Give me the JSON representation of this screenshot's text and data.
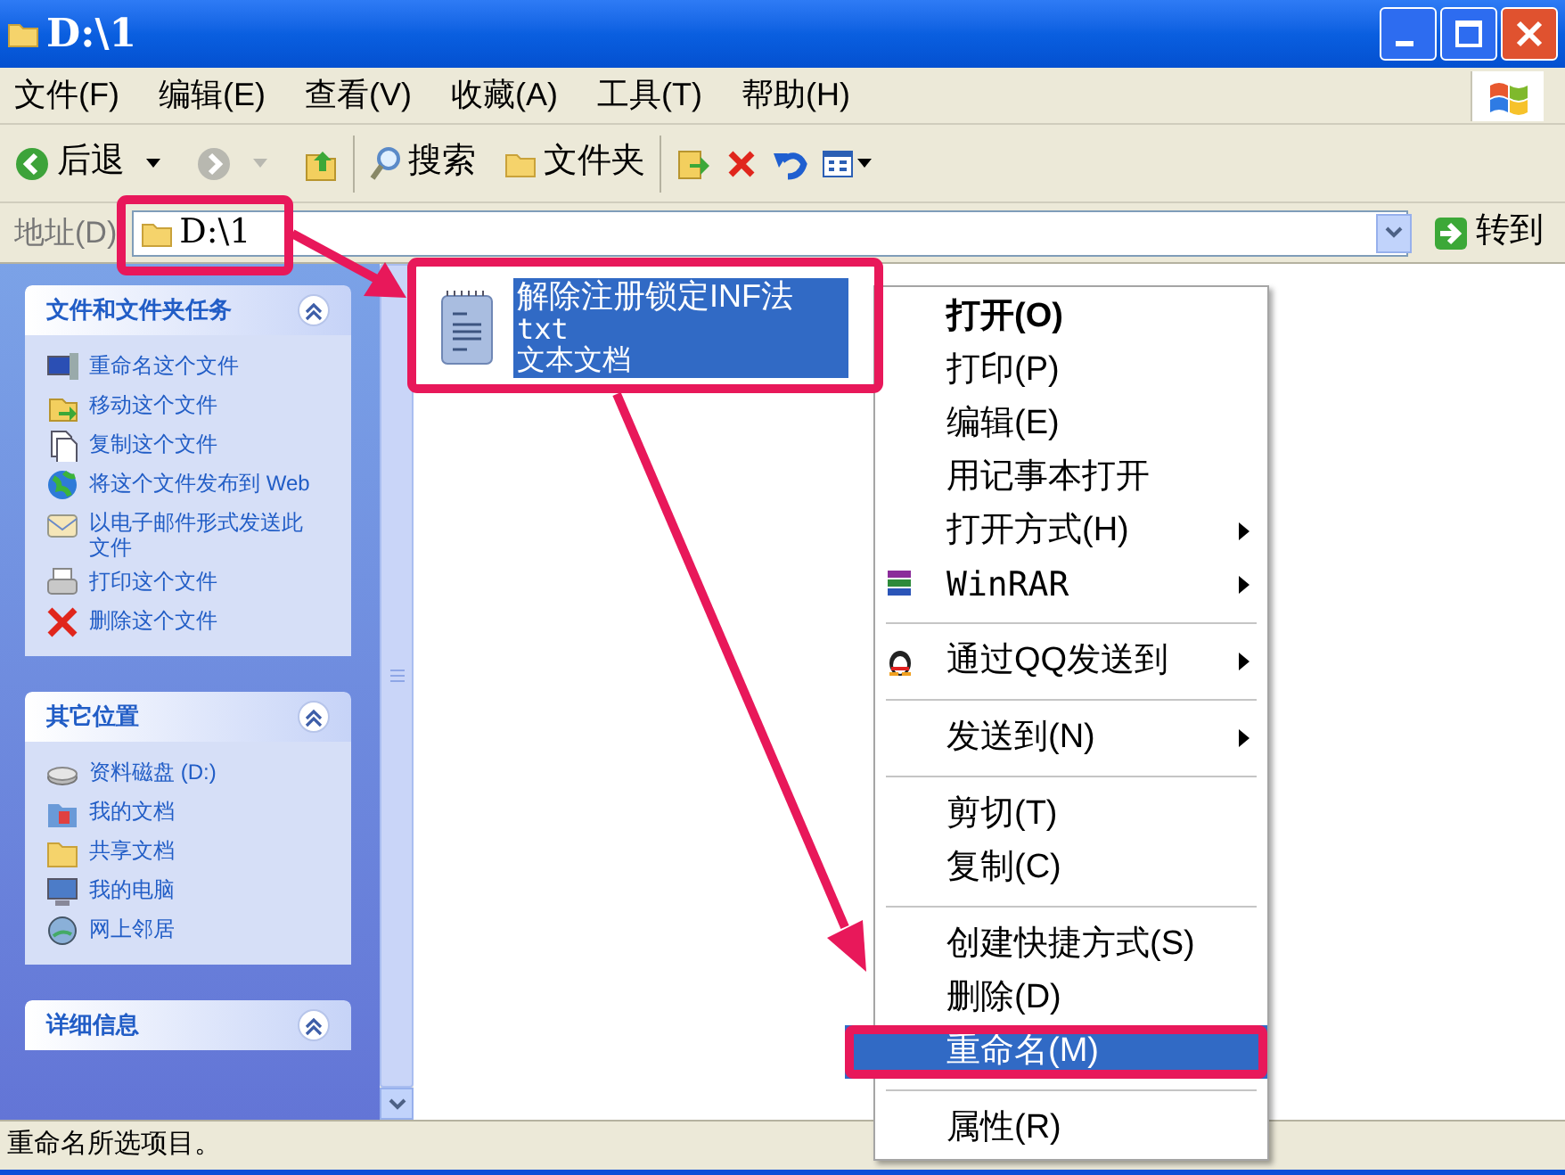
{
  "window": {
    "title": "D:\\1"
  },
  "menu_bar": [
    "文件(F)",
    "编辑(E)",
    "查看(V)",
    "收藏(A)",
    "工具(T)",
    "帮助(H)"
  ],
  "toolbar": {
    "back": "后退",
    "search": "搜索",
    "folders": "文件夹"
  },
  "address_bar": {
    "label": "地址(D)",
    "value": "D:\\1",
    "go": "转到"
  },
  "task_panes": [
    {
      "title": "文件和文件夹任务",
      "expanded": true,
      "items": [
        "重命名这个文件",
        "移动这个文件",
        "复制这个文件",
        "将这个文件发布到 Web",
        "以电子邮件形式发送此文件",
        "打印这个文件",
        "删除这个文件"
      ]
    },
    {
      "title": "其它位置",
      "expanded": true,
      "items": [
        "资料磁盘 (D:)",
        "我的文档",
        "共享文档",
        "我的电脑",
        "网上邻居"
      ]
    },
    {
      "title": "详细信息",
      "expanded": true
    }
  ],
  "file": {
    "name": "解除注册锁定INF法",
    "ext": "txt",
    "type": "文本文档",
    "selected": true
  },
  "context_menu": [
    {
      "kind": "item",
      "label": "打开(O)",
      "default": true,
      "submenu": false,
      "selected": false
    },
    {
      "kind": "item",
      "label": "打印(P)",
      "default": false,
      "submenu": false,
      "selected": false
    },
    {
      "kind": "item",
      "label": "编辑(E)",
      "default": false,
      "submenu": false,
      "selected": false
    },
    {
      "kind": "item",
      "label": "用记事本打开",
      "default": false,
      "submenu": false,
      "selected": false
    },
    {
      "kind": "item",
      "label": "打开方式(H)",
      "default": false,
      "submenu": true,
      "selected": false
    },
    {
      "kind": "item",
      "label": "WinRAR",
      "default": false,
      "submenu": true,
      "selected": false
    },
    {
      "kind": "separator"
    },
    {
      "kind": "item",
      "label": "通过QQ发送到",
      "default": false,
      "submenu": true,
      "selected": false
    },
    {
      "kind": "separator"
    },
    {
      "kind": "item",
      "label": "发送到(N)",
      "default": false,
      "submenu": true,
      "selected": false
    },
    {
      "kind": "separator"
    },
    {
      "kind": "item",
      "label": "剪切(T)",
      "default": false,
      "submenu": false,
      "selected": false
    },
    {
      "kind": "item",
      "label": "复制(C)",
      "default": false,
      "submenu": false,
      "selected": false
    },
    {
      "kind": "separator"
    },
    {
      "kind": "item",
      "label": "创建快捷方式(S)",
      "default": false,
      "submenu": false,
      "selected": false
    },
    {
      "kind": "item",
      "label": "删除(D)",
      "default": false,
      "submenu": false,
      "selected": false
    },
    {
      "kind": "item",
      "label": "重命名(M)",
      "default": false,
      "submenu": false,
      "selected": true
    },
    {
      "kind": "separator"
    },
    {
      "kind": "item",
      "label": "属性(R)",
      "default": false,
      "submenu": false,
      "selected": false
    }
  ],
  "status_bar": "重命名所选项目。"
}
